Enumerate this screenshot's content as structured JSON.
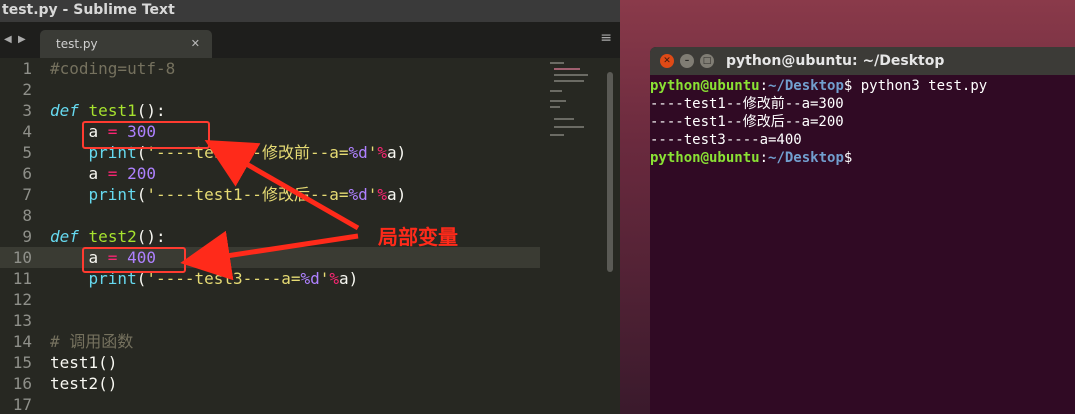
{
  "sublime": {
    "window_title": "test.py - Sublime Text",
    "nav_back": "◀",
    "nav_forward": "▶",
    "tab_label": "test.py",
    "tab_close": "✕",
    "menu_icon": "≡"
  },
  "editor": {
    "line_numbers": [
      "1",
      "2",
      "3",
      "4",
      "5",
      "6",
      "7",
      "8",
      "9",
      "10",
      "11",
      "12",
      "13",
      "14",
      "15",
      "16",
      "17"
    ],
    "code": {
      "l1": "#coding=utf-8",
      "l3_kw": "def",
      "l3_name": "test1",
      "l3_rest": "():",
      "l4_indent": "    ",
      "l4_var": "a",
      "l4_op": " = ",
      "l4_num": "300",
      "l5_indent": "    ",
      "l5_fn": "print",
      "l5_open": "(",
      "l5_str1": "'----test1--",
      "l5_cn": "修改前",
      "l5_str2": "--a=",
      "l5_fmt": "%d",
      "l5_q": "'",
      "l5_op": "%",
      "l5_rest": "a)",
      "l6_indent": "    ",
      "l6_var": "a",
      "l6_op": " = ",
      "l6_num": "200",
      "l7_indent": "    ",
      "l7_fn": "print",
      "l7_open": "(",
      "l7_str1": "'----test1--",
      "l7_cn": "修改后",
      "l7_str2": "--a=",
      "l7_fmt": "%d",
      "l7_q": "'",
      "l7_op": "%",
      "l7_rest": "a)",
      "l9_kw": "def",
      "l9_name": "test2",
      "l9_rest": "():",
      "l10_indent": "    ",
      "l10_var": "a",
      "l10_op": " = ",
      "l10_num": "400",
      "l11_indent": "    ",
      "l11_fn": "print",
      "l11_open": "(",
      "l11_str1": "'----test3----a=",
      "l11_fmt": "%d",
      "l11_q": "'",
      "l11_op": "%",
      "l11_rest": "a)",
      "l14": "# 调用函数",
      "l15": "test1()",
      "l16": "test2()"
    }
  },
  "annotation": {
    "label": "局部变量",
    "color": "#ff2a1a"
  },
  "terminal": {
    "title": "python@ubuntu: ~/Desktop",
    "close_glyph": "✕",
    "min_glyph": "–",
    "max_glyph": "□",
    "prompt_user": "python@ubuntu",
    "prompt_sep": ":",
    "prompt_path": "~/Desktop",
    "prompt_dollar": "$",
    "command": " python3 test.py",
    "out1": "----test1--修改前--a=300",
    "out2": "----test1--修改后--a=200",
    "out3": "----test3----a=400"
  },
  "colors": {
    "editor_bg": "#272822",
    "terminal_bg": "#300a24",
    "prompt_user": "#8ae234",
    "prompt_path": "#729fcf",
    "highlight_box": "#ff3b30"
  }
}
